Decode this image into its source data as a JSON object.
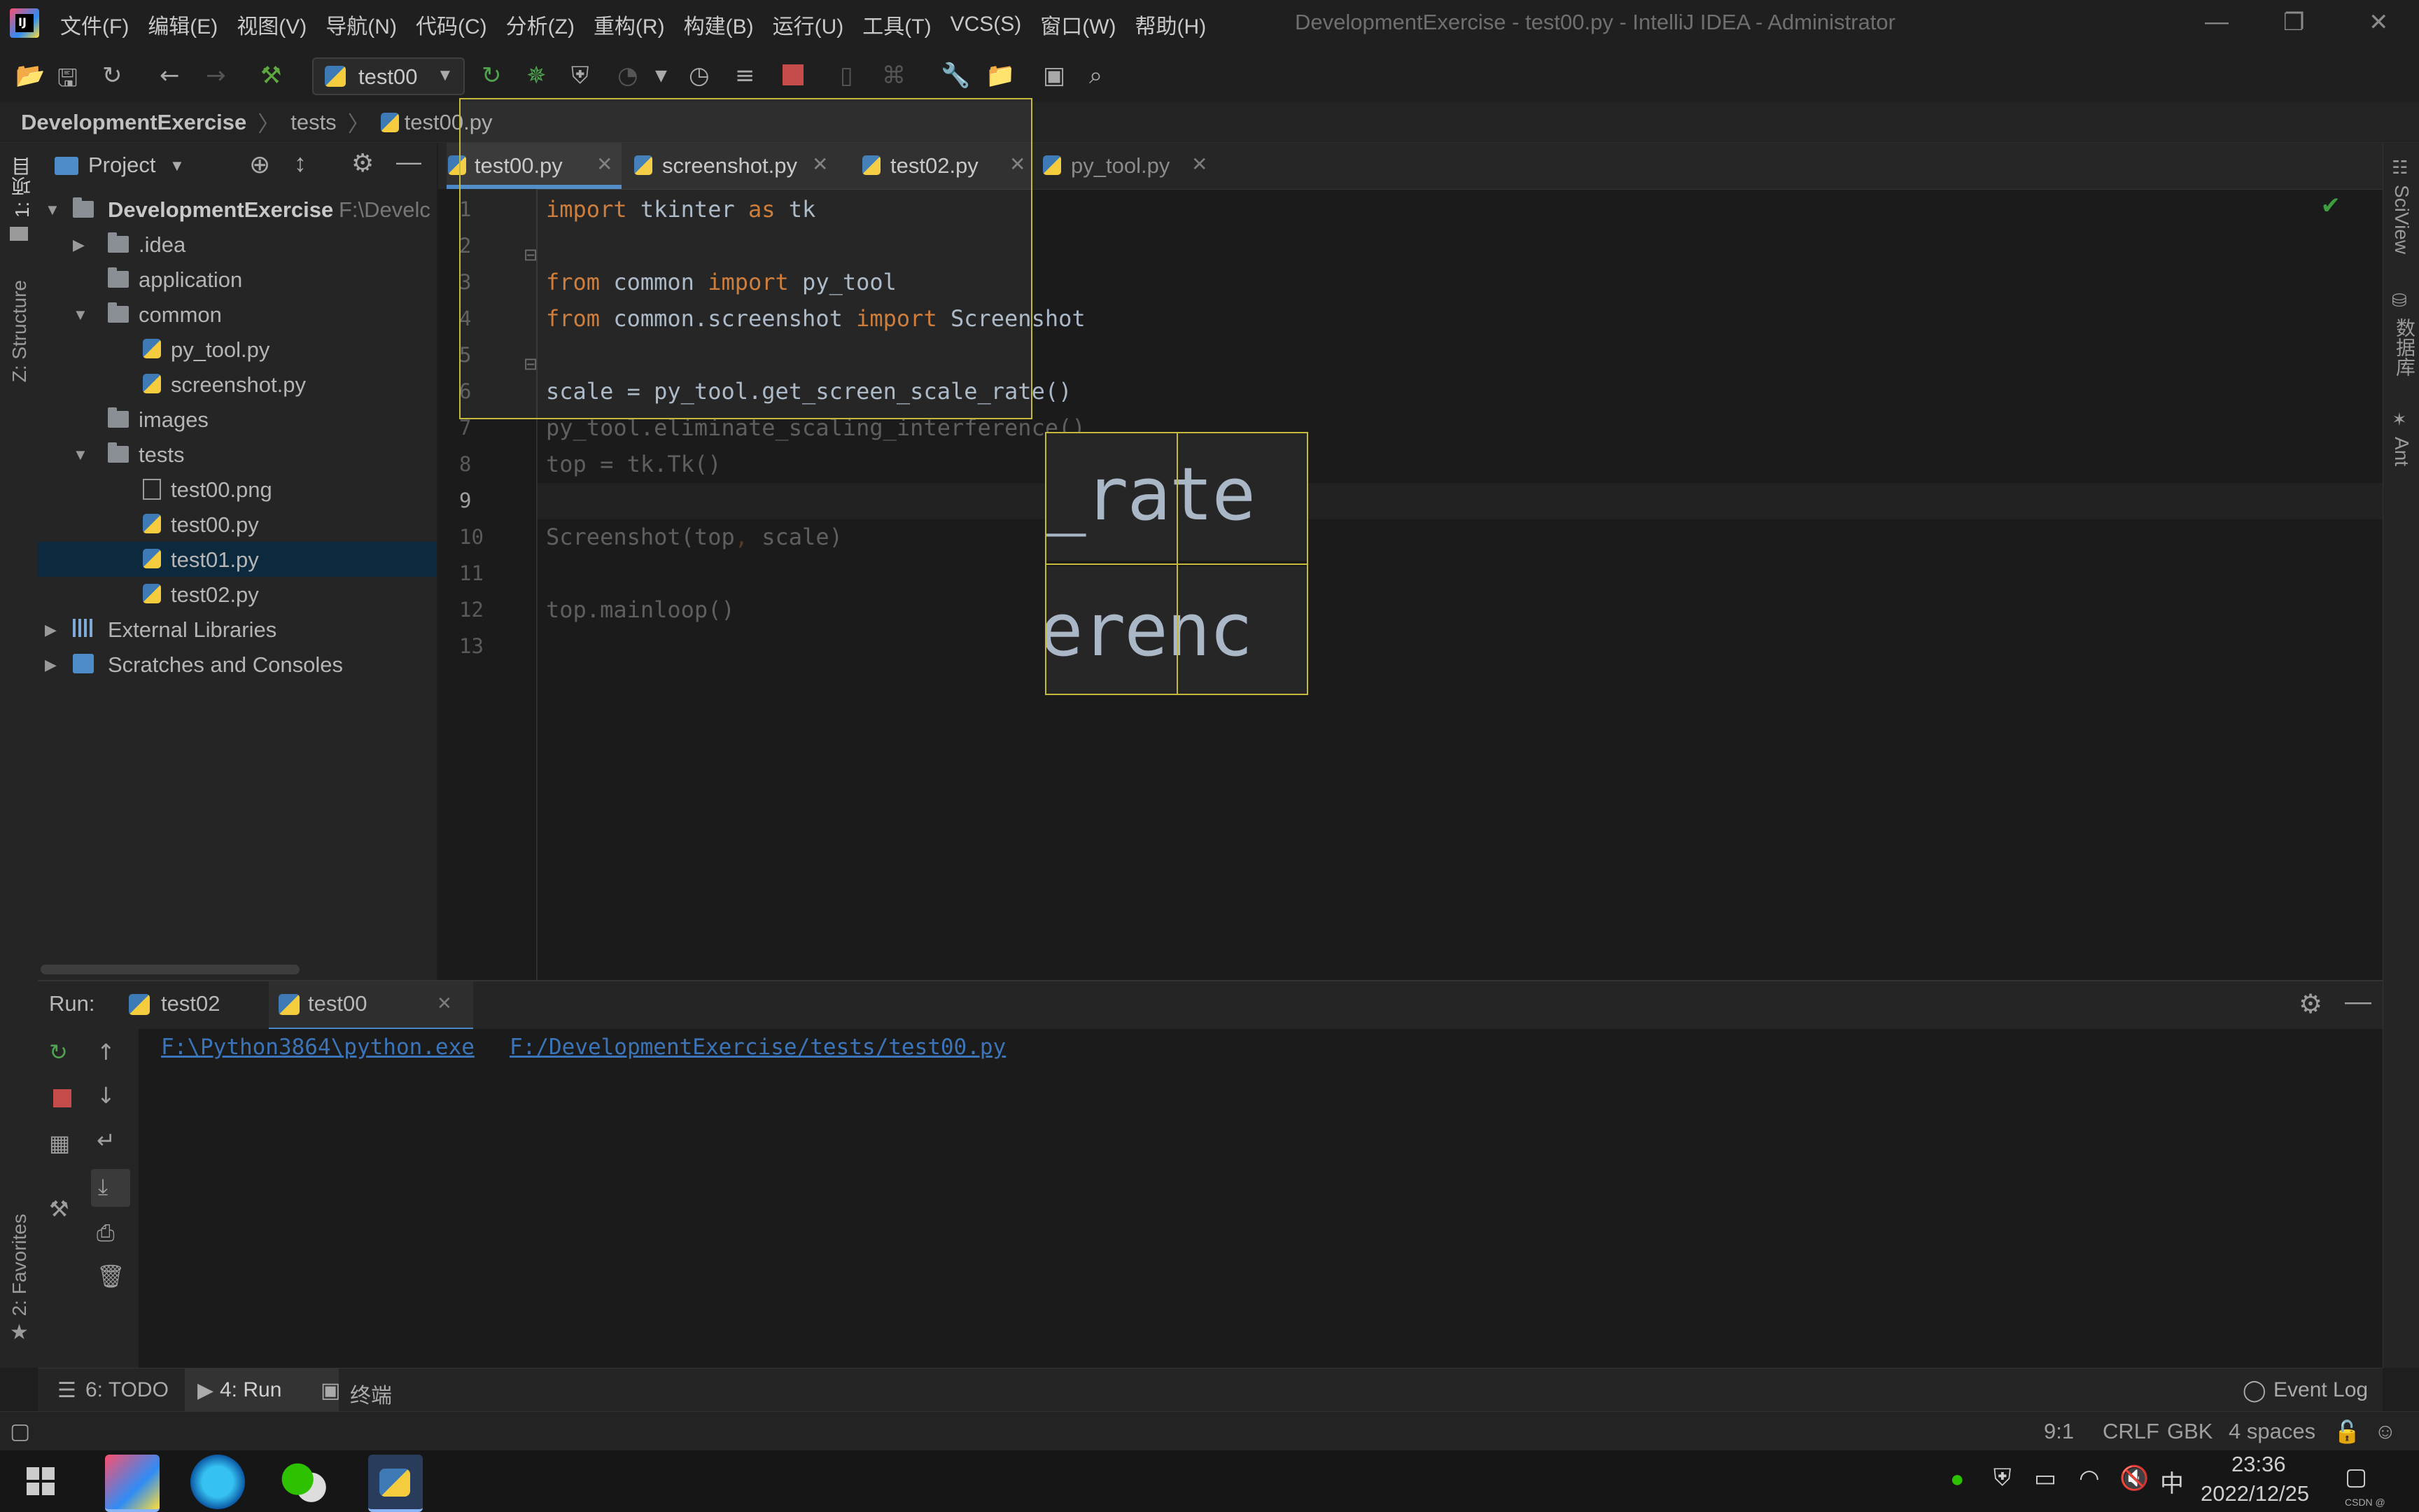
{
  "menubar": {
    "items": [
      "文件(F)",
      "编辑(E)",
      "视图(V)",
      "导航(N)",
      "代码(C)",
      "分析(Z)",
      "重构(R)",
      "构建(B)",
      "运行(U)",
      "工具(T)",
      "VCS(S)",
      "窗口(W)",
      "帮助(H)"
    ],
    "title": "DevelopmentExercise - test00.py - IntelliJ IDEA - Administrator"
  },
  "toolbar": {
    "run_config": "test00"
  },
  "breadcrumb": [
    "DevelopmentExercise",
    "tests",
    "test00.py"
  ],
  "left_strip": {
    "project_label": "1: 项目",
    "structure_label": "Z: Structure",
    "favorites_label": "2: Favorites"
  },
  "right_strip": {
    "sciview": "SciView",
    "database": "数据库",
    "ant": "Ant"
  },
  "project": {
    "header": "Project",
    "root": "DevelopmentExercise",
    "root_path": "F:\\Develc",
    "tree": [
      ".idea",
      "application",
      "common",
      "py_tool.py",
      "screenshot.py",
      "images",
      "tests",
      "test00.png",
      "test00.py",
      "test01.py",
      "test02.py"
    ],
    "external_libraries": "External Libraries",
    "scratches": "Scratches and Consoles"
  },
  "tabs": [
    "test00.py",
    "screenshot.py",
    "test02.py",
    "py_tool.py"
  ],
  "code": {
    "line_numbers": [
      "1",
      "2",
      "3",
      "4",
      "5",
      "6",
      "7",
      "8",
      "9",
      "10",
      "11",
      "12",
      "13"
    ],
    "l1": {
      "k1": "import",
      "t1": " tkinter ",
      "k2": "as",
      "t2": " tk"
    },
    "l3": {
      "k1": "from",
      "t1": " common ",
      "k2": "import",
      "t2": " py_tool"
    },
    "l4": {
      "k1": "from",
      "t1": " common.screenshot ",
      "k2": "import",
      "t2": " Screenshot"
    },
    "l6": "scale = py_tool.get_screen_scale_rate()",
    "l7": "py_tool.eliminate_scaling_interference()",
    "l8": "top = tk.Tk()",
    "l10": {
      "a": "Screenshot(top",
      "b": ", ",
      "c": "scale)"
    },
    "l12": "top.mainloop()"
  },
  "magnifier": {
    "row1": "_rate",
    "row2": "erenc"
  },
  "run": {
    "label": "Run:",
    "tabs": [
      "test02",
      "test00"
    ],
    "output_exe": "F:\\Python3864\\python.exe",
    "output_script": "F:/DevelopmentExercise/tests/test00.py"
  },
  "bottom_tabs": {
    "todo": "6: TODO",
    "run": "4: Run",
    "terminal": "终端",
    "event_log": "Event Log"
  },
  "status": {
    "position": "9:1",
    "line_sep": "CRLF",
    "encoding": "GBK",
    "indent": "4 spaces"
  },
  "taskbar": {
    "ime": "中",
    "time": "23:36",
    "date": "2022/12/25",
    "watermark": "CSDN @"
  },
  "colors": {
    "keyword": "#cc7832",
    "selection_border": "#c4b93c",
    "link": "#3b74b8",
    "accent_tab": "#4a88c7"
  }
}
